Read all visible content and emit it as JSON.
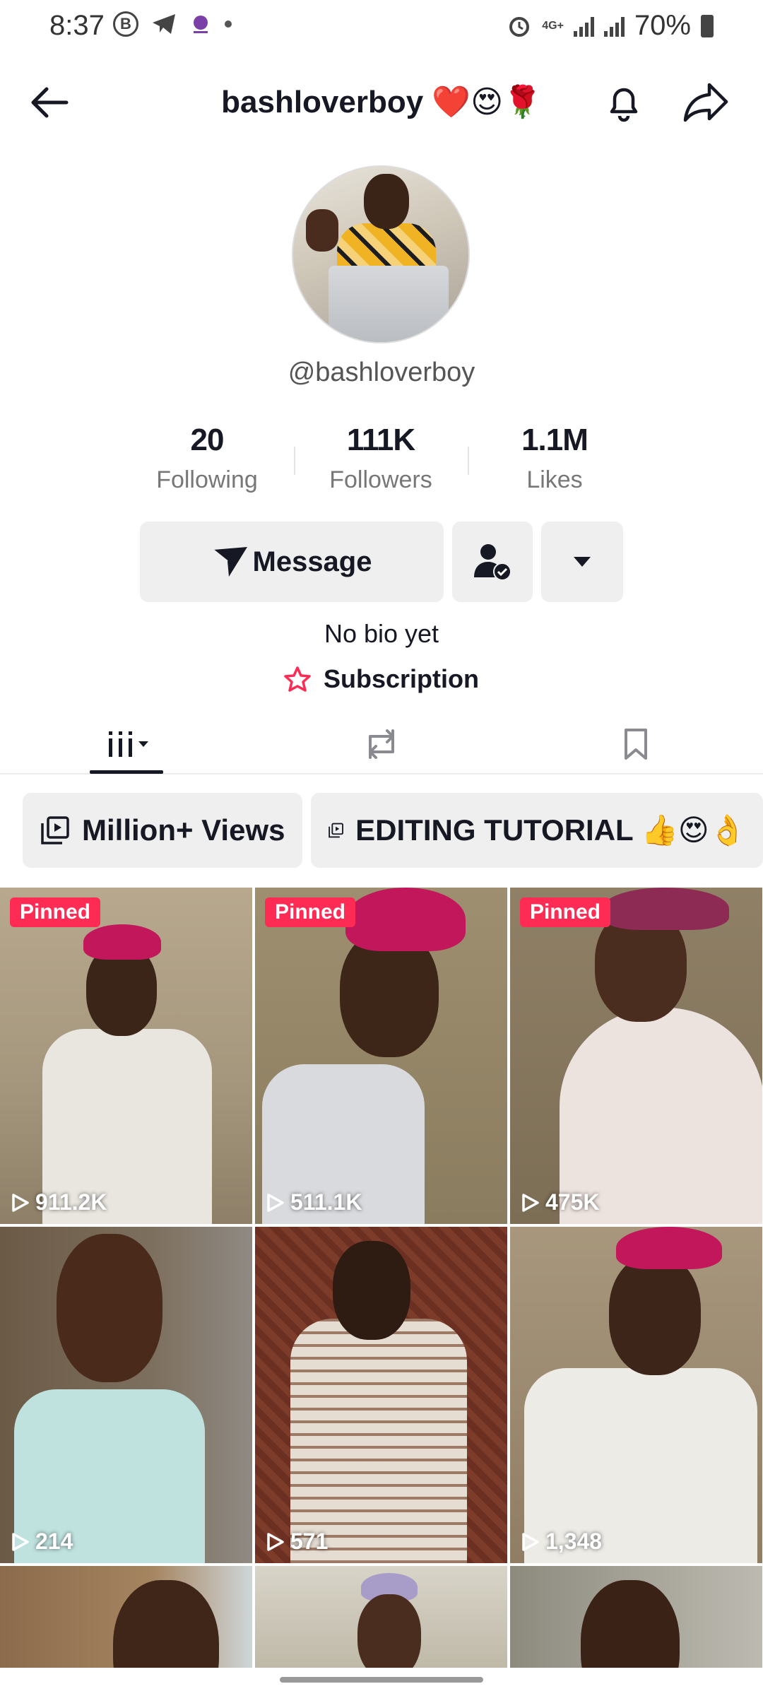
{
  "status_bar": {
    "time": "8:37",
    "b_badge": "B",
    "network": "4G+",
    "battery": "70%"
  },
  "header": {
    "title": "bashloverboy ❤️😍🌹"
  },
  "profile": {
    "handle": "@bashloverboy",
    "stats": [
      {
        "value": "20",
        "label": "Following"
      },
      {
        "value": "111K",
        "label": "Followers"
      },
      {
        "value": "1.1M",
        "label": "Likes"
      }
    ],
    "message_label": "Message",
    "bio": "No bio yet",
    "subscription_label": "Subscription"
  },
  "playlists": [
    {
      "label": "Million+ Views"
    },
    {
      "label": "EDITING TUTORIAL 👍😍👌"
    }
  ],
  "videos": [
    {
      "pinned": "Pinned",
      "views": "911.2K"
    },
    {
      "pinned": "Pinned",
      "views": "511.1K"
    },
    {
      "pinned": "Pinned",
      "views": "475K"
    },
    {
      "views": "214"
    },
    {
      "views": "571"
    },
    {
      "views": "1,348"
    }
  ],
  "colors": {
    "accent": "#fe2c55",
    "text": "#161823",
    "button_bg": "#efefef"
  }
}
